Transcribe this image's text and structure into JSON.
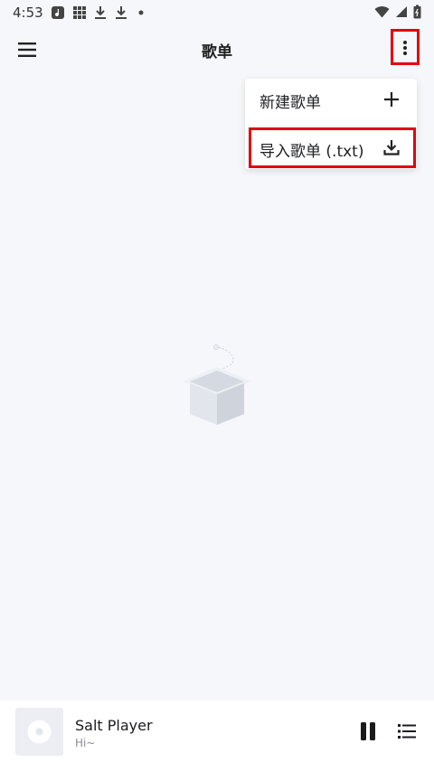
{
  "status_bar": {
    "time": "4:53"
  },
  "app_bar": {
    "title": "歌单",
    "menu_icon": "hamburger-menu-icon",
    "more_icon": "more-vert-icon"
  },
  "overflow_menu": {
    "items": [
      {
        "label": "新建歌单",
        "icon": "plus-icon"
      },
      {
        "label": "导入歌单 (.txt)",
        "icon": "download-icon"
      }
    ]
  },
  "empty_state": {
    "icon": "empty-box-icon"
  },
  "mini_player": {
    "title": "Salt Player",
    "subtitle": "Hi~",
    "pause_icon": "pause-icon",
    "queue_icon": "queue-list-icon"
  },
  "colors": {
    "background": "#f6f7fb",
    "highlight": "#e3000f",
    "surface": "#ffffff"
  }
}
